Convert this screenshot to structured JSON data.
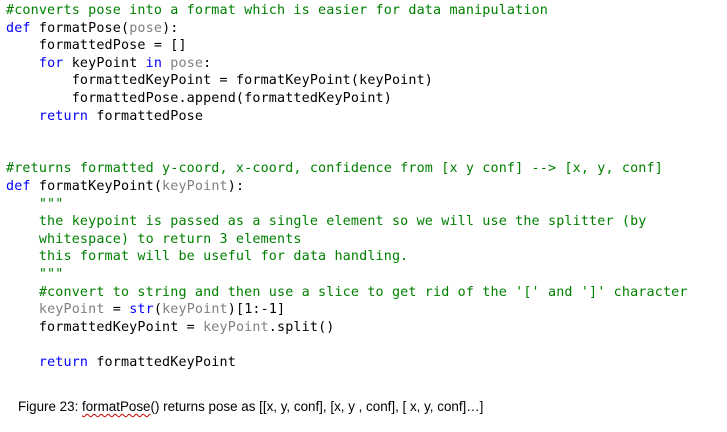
{
  "code_lines": [
    [
      {
        "t": "#converts pose into a format which is easier for data manipulation",
        "c": "comment"
      }
    ],
    [
      {
        "t": "def ",
        "c": "keyword"
      },
      {
        "t": "formatPose(",
        "c": "plain"
      },
      {
        "t": "pose",
        "c": "param"
      },
      {
        "t": "):",
        "c": "plain"
      }
    ],
    [
      {
        "t": "    formattedPose = []",
        "c": "plain"
      }
    ],
    [
      {
        "t": "    ",
        "c": "plain"
      },
      {
        "t": "for ",
        "c": "keyword"
      },
      {
        "t": "keyPoint ",
        "c": "plain"
      },
      {
        "t": "in ",
        "c": "keyword"
      },
      {
        "t": "pose",
        "c": "param"
      },
      {
        "t": ":",
        "c": "plain"
      }
    ],
    [
      {
        "t": "        formattedKeyPoint = formatKeyPoint(keyPoint)",
        "c": "plain"
      }
    ],
    [
      {
        "t": "        formattedPose.append(formattedKeyPoint)",
        "c": "plain"
      }
    ],
    [
      {
        "t": "    ",
        "c": "plain"
      },
      {
        "t": "return ",
        "c": "keyword"
      },
      {
        "t": "formattedPose",
        "c": "plain"
      }
    ],
    [],
    [],
    [
      {
        "t": "#returns formatted y-coord, x-coord, confidence from [x y conf] --> [x, y, conf]",
        "c": "comment"
      }
    ],
    [
      {
        "t": "def ",
        "c": "keyword"
      },
      {
        "t": "formatKeyPoint(",
        "c": "plain"
      },
      {
        "t": "keyPoint",
        "c": "param"
      },
      {
        "t": "):",
        "c": "plain"
      }
    ],
    [
      {
        "t": "    \"\"\"",
        "c": "comment"
      }
    ],
    [
      {
        "t": "    the keypoint is passed as a single element so we will use the splitter (by",
        "c": "comment"
      }
    ],
    [
      {
        "t": "    whitespace) to return 3 elements",
        "c": "comment"
      }
    ],
    [
      {
        "t": "    this format will be useful for data handling.",
        "c": "comment"
      }
    ],
    [
      {
        "t": "    \"\"\"",
        "c": "comment"
      }
    ],
    [
      {
        "t": "    #convert to string and then use a slice to get rid of the '[' and ']' character",
        "c": "comment"
      }
    ],
    [
      {
        "t": "    ",
        "c": "plain"
      },
      {
        "t": "keyPoint",
        "c": "param"
      },
      {
        "t": " = ",
        "c": "plain"
      },
      {
        "t": "str",
        "c": "keyword"
      },
      {
        "t": "(",
        "c": "plain"
      },
      {
        "t": "keyPoint",
        "c": "param"
      },
      {
        "t": ")[1:-1]",
        "c": "plain"
      }
    ],
    [
      {
        "t": "    formattedKeyPoint = ",
        "c": "plain"
      },
      {
        "t": "keyPoint",
        "c": "param"
      },
      {
        "t": ".split()",
        "c": "plain"
      }
    ],
    [],
    [
      {
        "t": "    ",
        "c": "plain"
      },
      {
        "t": "return ",
        "c": "keyword"
      },
      {
        "t": "formattedKeyPoint",
        "c": "plain"
      }
    ]
  ],
  "colors": {
    "comment": "#008000",
    "keyword": "#0000ff",
    "param": "#808080",
    "plain": "#000000",
    "spellcheck": "#cc0000"
  },
  "caption": {
    "prefix": "Figure 23: ",
    "underlined": "formatPose",
    "suffix": "() returns pose as [[x, y, conf], [x, y , conf], [ x, y, conf]…]"
  }
}
